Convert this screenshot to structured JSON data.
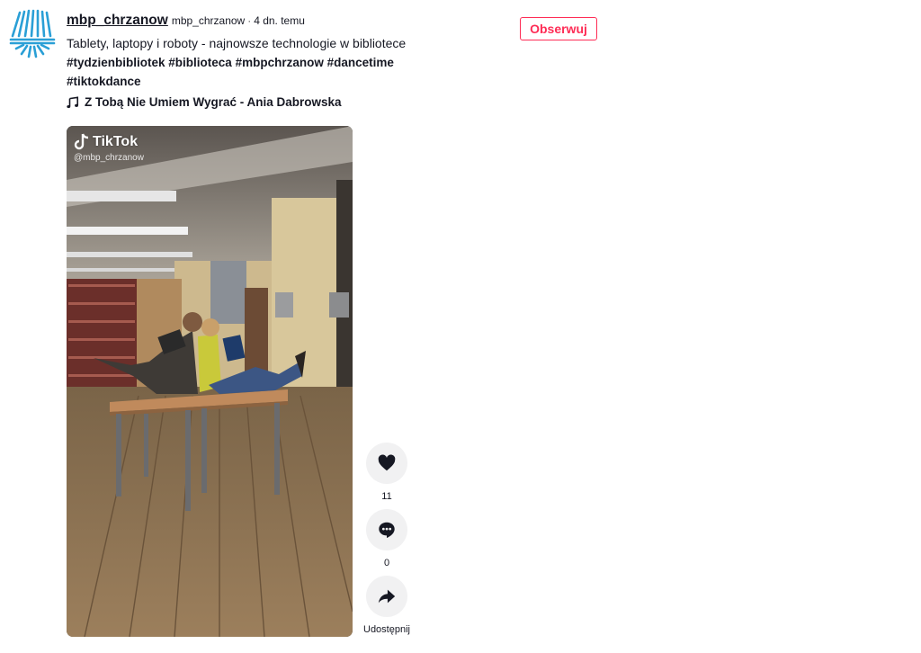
{
  "post": {
    "username": "mbp_chrzanow",
    "nickname": "mbp_chrzanow",
    "separator": "·",
    "time": "4 dn. temu",
    "description": "Tablety, laptopy i roboty - najnowsze technologie w bibliotece",
    "hashtags": [
      "#tydzienbibliotek",
      "#biblioteca",
      "#mbpchrzanow",
      "#dancetime",
      "#tiktokdance"
    ],
    "music": "Z Tobą Nie Umiem Wygrać - Ania Dabrowska",
    "follow_label": "Obserwuj"
  },
  "video": {
    "watermark_brand": "TikTok",
    "watermark_handle": "@mbp_chrzanow"
  },
  "actions": {
    "likes": "11",
    "comments": "0",
    "share_label": "Udostępnij"
  },
  "colors": {
    "accent": "#fe2c55",
    "text": "#161823",
    "button_bg": "#f1f1f2",
    "avatar_blue": "#2a9fd6"
  },
  "icons": {
    "avatar": "library-logo-icon",
    "music": "music-note-icon",
    "like": "heart-icon",
    "comment": "comment-icon",
    "share": "share-arrow-icon"
  }
}
